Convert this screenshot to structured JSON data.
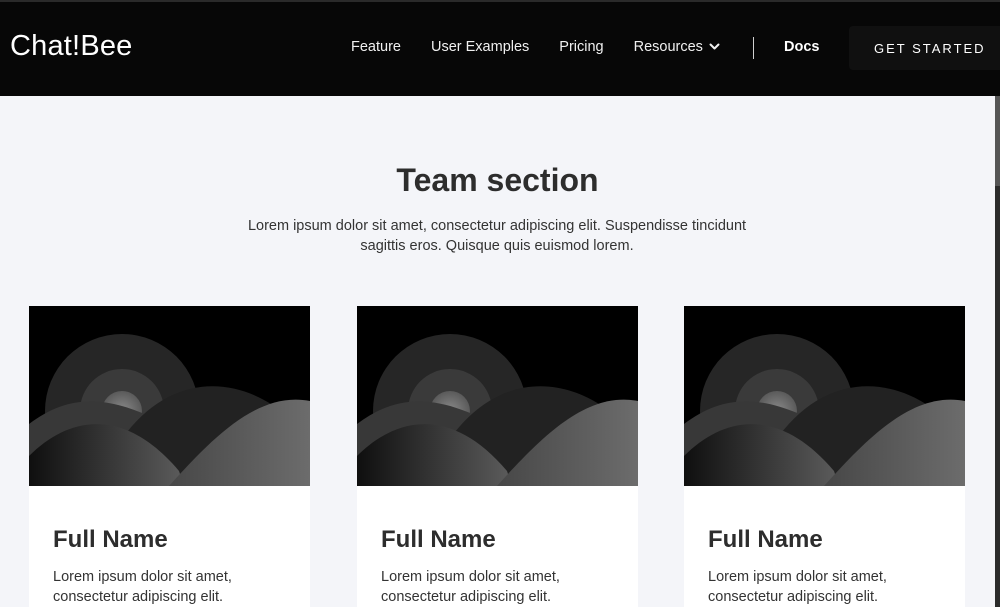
{
  "nav": {
    "logo": "Chat!Bee",
    "links": [
      "Feature",
      "User Examples",
      "Pricing"
    ],
    "resources_label": "Resources",
    "docs_label": "Docs",
    "cta_label": "GET STARTED"
  },
  "team": {
    "title": "Team section",
    "subtitle": "Lorem ipsum dolor sit amet, consectetur adipiscing elit. Suspendisse tincidunt sagittis eros. Quisque quis euismod lorem.",
    "members": [
      {
        "name": "Full Name",
        "description": "Lorem ipsum dolor sit amet, consectetur adipiscing elit."
      },
      {
        "name": "Full Name",
        "description": "Lorem ipsum dolor sit amet, consectetur adipiscing elit."
      },
      {
        "name": "Full Name",
        "description": "Lorem ipsum dolor sit amet, consectetur adipiscing elit."
      }
    ]
  },
  "icons": {
    "resources_chevron": "chevron-down-icon",
    "member_image": "landscape-placeholder-image"
  },
  "colors": {
    "navbar_bg": "#070707",
    "page_bg": "#f4f5f9",
    "card_bg": "#ffffff",
    "text": "#2d2d2d"
  }
}
